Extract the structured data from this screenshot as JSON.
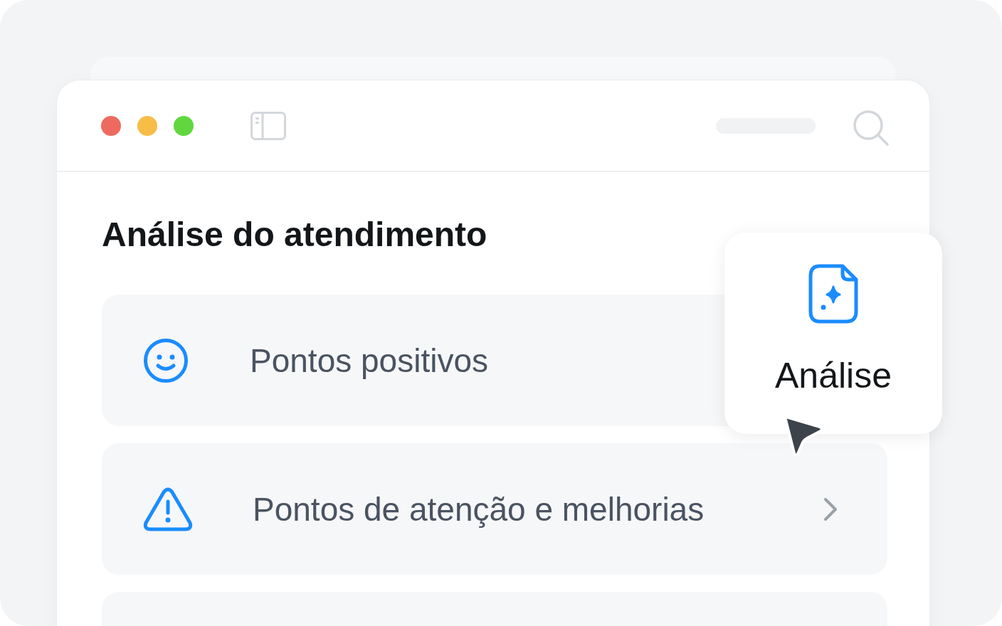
{
  "window": {
    "controls": [
      {
        "color": "#ee6a5f"
      },
      {
        "color": "#f7bd47"
      },
      {
        "color": "#61d73f"
      }
    ]
  },
  "heading": "Análise do atendimento",
  "items": [
    {
      "kind": "smile",
      "label": "Pontos positivos"
    },
    {
      "kind": "warning",
      "label": "Pontos de atenção e melhorias",
      "chevron": true
    }
  ],
  "popup": {
    "label": "Análise"
  }
}
